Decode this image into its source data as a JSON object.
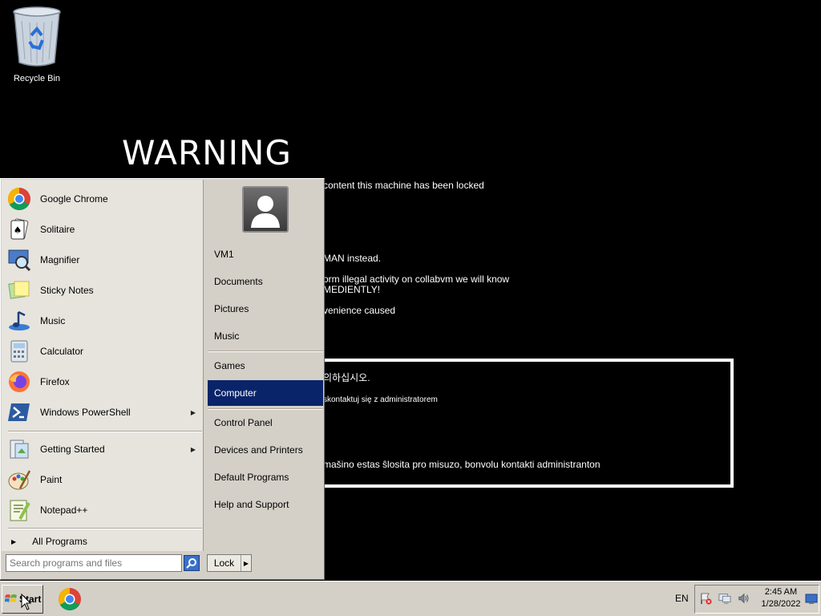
{
  "desktop": {
    "recycle_bin_label": "Recycle Bin",
    "warning": {
      "title": "WARNING",
      "lines": [
        "content this machine has been locked",
        "MAN instead.",
        "orm illegal activity on collabvm we will know",
        "MEDIENTLY!",
        "venience caused"
      ],
      "box_lines": [
        "의하십시오.",
        "skontaktuj się z administratorem",
        "mašino estas ŝlosita pro misuzo, bonvolu kontakti administranton"
      ]
    }
  },
  "start_menu": {
    "programs": [
      {
        "label": "Google Chrome",
        "icon": "chrome-icon"
      },
      {
        "label": "Solitaire",
        "icon": "solitaire-icon"
      },
      {
        "label": "Magnifier",
        "icon": "magnifier-icon"
      },
      {
        "label": "Sticky Notes",
        "icon": "sticky-notes-icon"
      },
      {
        "label": "Music",
        "icon": "music-icon"
      },
      {
        "label": "Calculator",
        "icon": "calculator-icon"
      },
      {
        "label": "Firefox",
        "icon": "firefox-icon"
      },
      {
        "label": "Windows PowerShell",
        "icon": "powershell-icon",
        "submenu": true
      },
      {
        "label": "Getting Started",
        "icon": "getting-started-icon",
        "submenu": true
      },
      {
        "label": "Paint",
        "icon": "paint-icon"
      },
      {
        "label": "Notepad++",
        "icon": "notepadpp-icon"
      }
    ],
    "all_programs_label": "All Programs",
    "search_placeholder": "Search programs and files",
    "places": [
      {
        "label": "VM1"
      },
      {
        "label": "Documents"
      },
      {
        "label": "Pictures"
      },
      {
        "label": "Music"
      },
      {
        "label": "Games"
      },
      {
        "label": "Computer",
        "active": true
      },
      {
        "label": "Control Panel"
      },
      {
        "label": "Devices and Printers"
      },
      {
        "label": "Default Programs"
      },
      {
        "label": "Help and Support"
      }
    ],
    "lock_label": "Lock"
  },
  "taskbar": {
    "start_label": "Start",
    "language": "EN",
    "time": "2:45 AM",
    "date": "1/28/2022"
  },
  "colors": {
    "selection": "#0a246a",
    "menu_bg": "#d4d0c8",
    "desktop_bg": "#000000"
  }
}
